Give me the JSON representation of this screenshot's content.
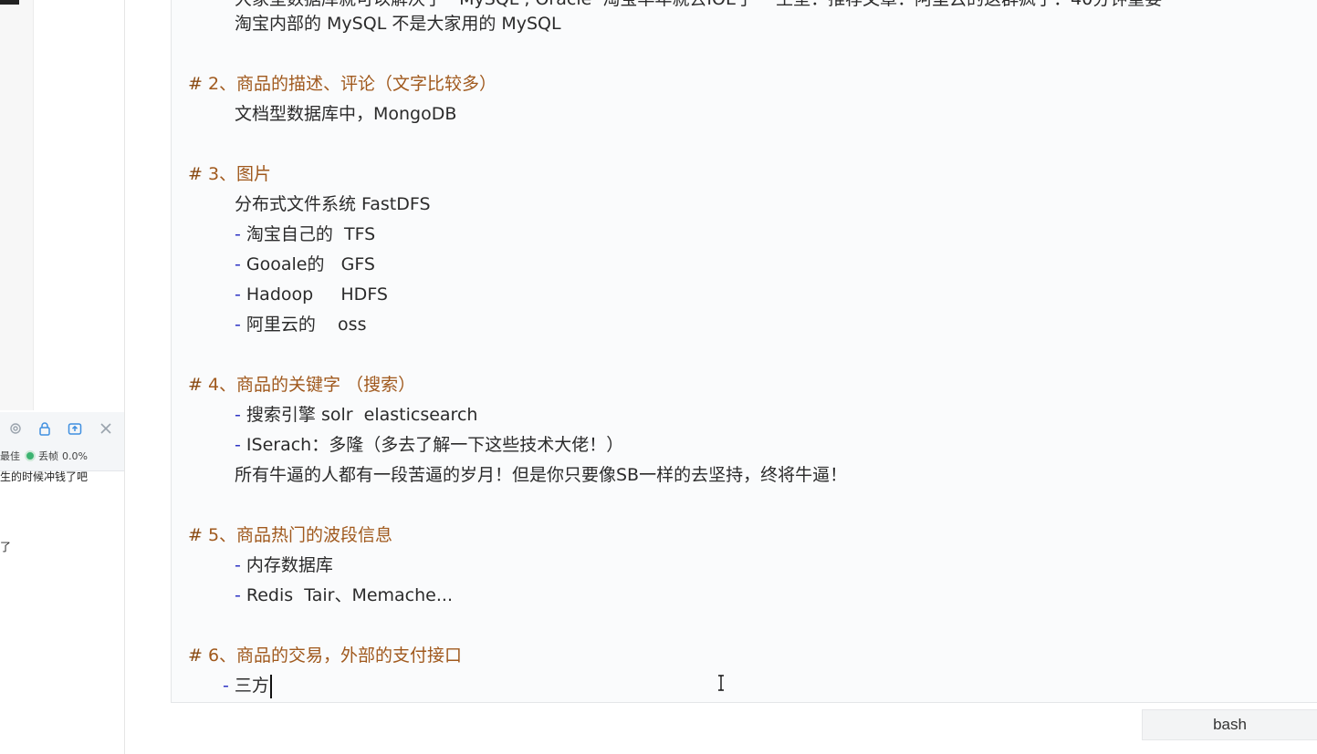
{
  "sidebar": {
    "toolbar": {
      "icons": [
        "gear-icon",
        "lock-icon",
        "share-icon",
        "close-icon"
      ],
      "status_left": "最佳",
      "status_drop_label": "丢帧",
      "status_drop_value": "0.0%"
    },
    "chat_lines": [
      "生的时候冲钱了吧",
      "了"
    ]
  },
  "editor": {
    "lines": {
      "l0": "大家型数据库就可以解决了   MySQL , Oracle  淘宝早年就去IOE了    王坚：推荐文章：阿里云的这群疯子：40分钟重要",
      "l1": "淘宝内部的 MySQL 不是大家用的 MySQL",
      "h2_hash": "#",
      "h2_text": " 2、商品的描述、评论（文字比较多）",
      "l3": "文档型数据库中，MongoDB",
      "h3_hash": "#",
      "h3_text": " 3、图片",
      "l5": "分布式文件系统 FastDFS",
      "l6": " 淘宝自己的  TFS",
      "l7": " Gooale的   GFS",
      "l8": " Hadoop     HDFS",
      "l9": " 阿里云的    oss",
      "h4_hash": "#",
      "h4_text": " 4、商品的关键字 （搜索）",
      "l11": " 搜索引擎 solr  elasticsearch",
      "l12": " ISerach：多隆（多去了解一下这些技术大佬！）",
      "l13": "所有牛逼的人都有一段苦逼的岁月！但是你只要像SB一样的去坚持，终将牛逼！",
      "h5_hash": "#",
      "h5_text": " 5、商品热门的波段信息",
      "l15": " 内存数据库",
      "l16": " Redis  Tair、Memache...",
      "h6_hash": "#",
      "h6_text": " 6、商品的交易，外部的支付接口",
      "l18": " 三方",
      "dash": "-"
    }
  },
  "terminal_tab": {
    "label": "bash"
  }
}
